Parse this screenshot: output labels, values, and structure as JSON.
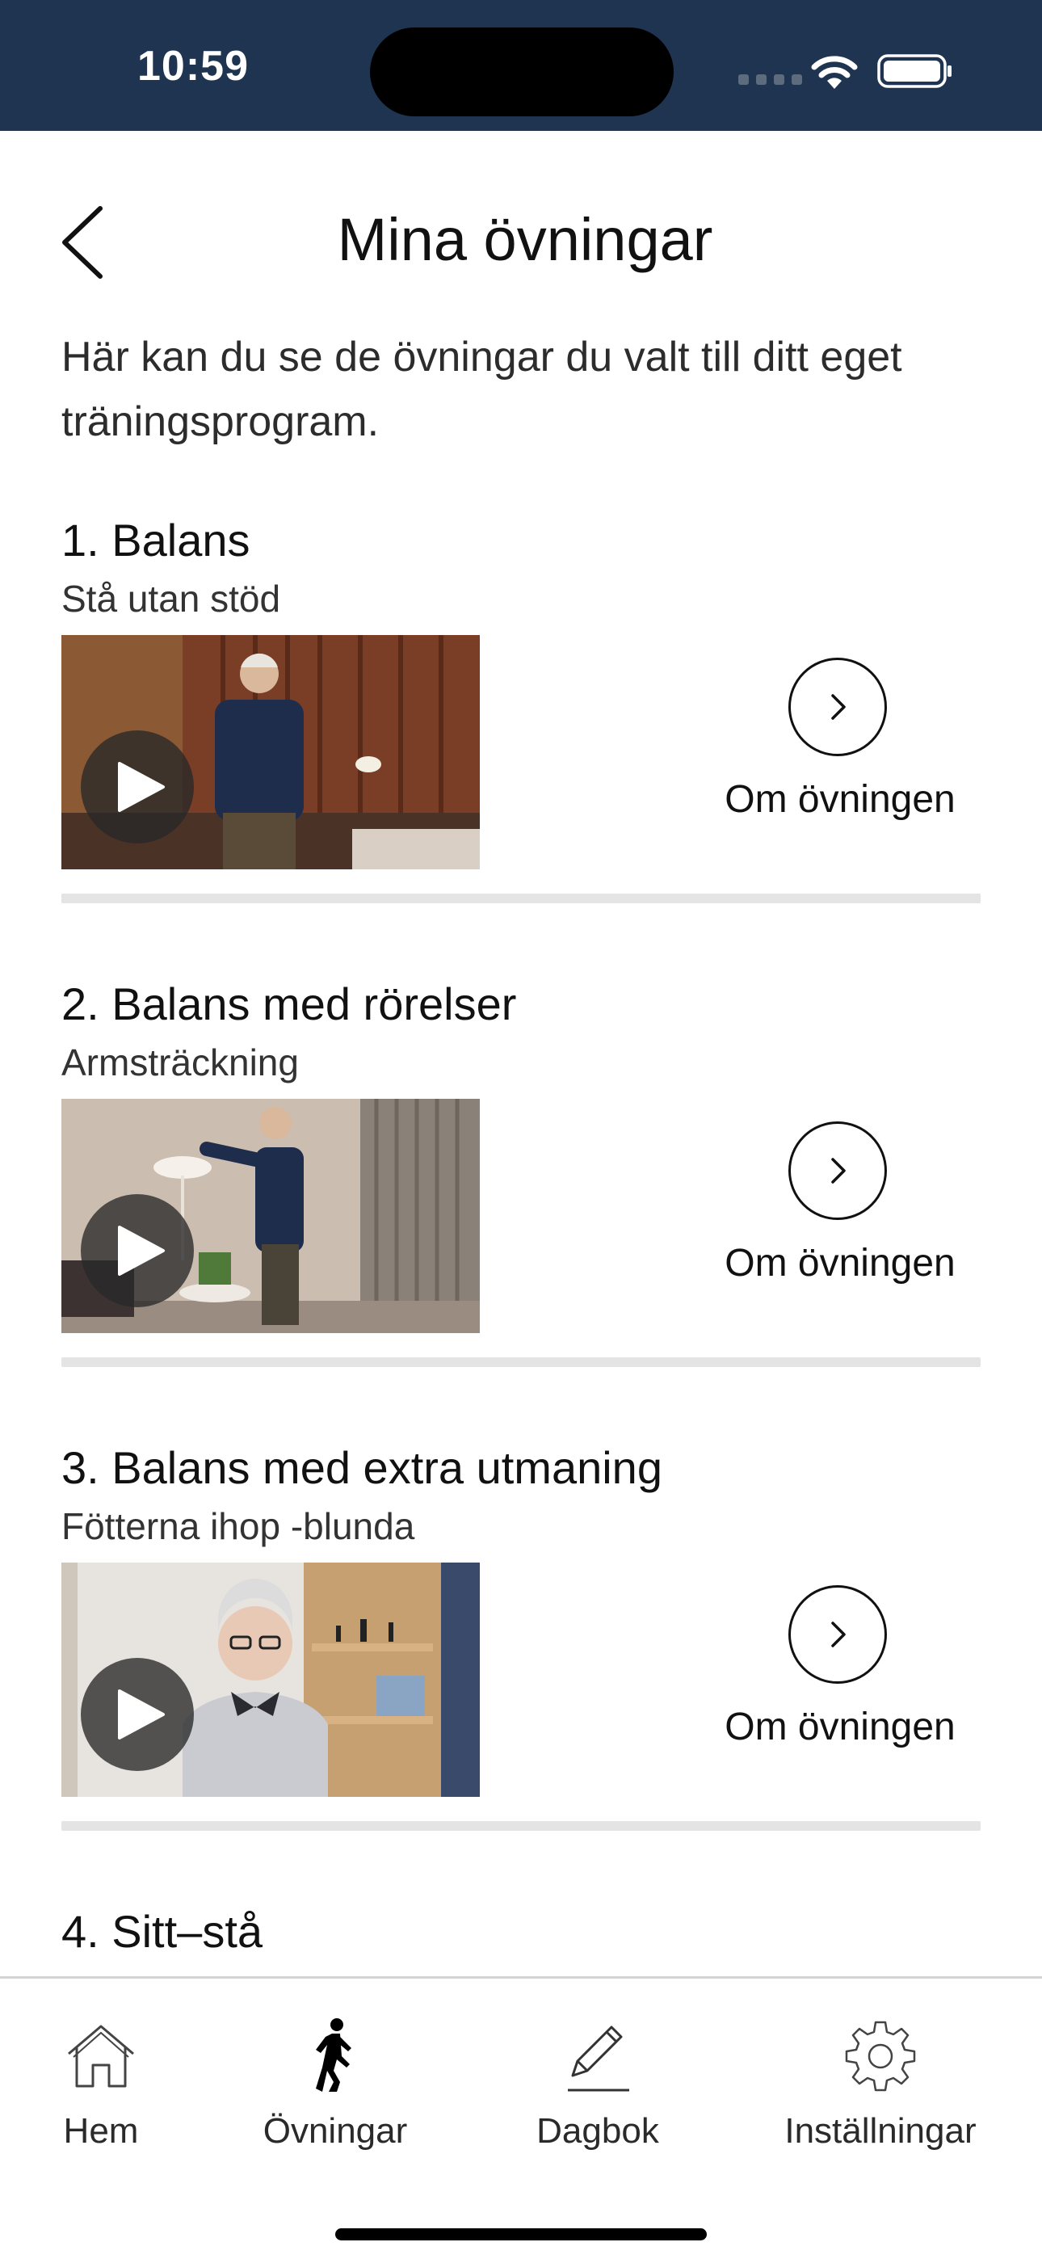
{
  "status_bar": {
    "time": "10:59"
  },
  "header": {
    "back_icon": "chevron-left-icon",
    "title": "Mina övningar"
  },
  "intro": {
    "text": "Här kan du se de övningar du valt till ditt eget träningsprogram."
  },
  "exercises": [
    {
      "title": "1. Balans",
      "subtitle": "Stå utan stöd",
      "about_label": "Om övningen"
    },
    {
      "title": "2. Balans med rörelser",
      "subtitle": "Armsträckning",
      "about_label": "Om övningen"
    },
    {
      "title": "3. Balans med extra utmaning",
      "subtitle": "Fötterna ihop -blunda",
      "about_label": "Om övningen"
    },
    {
      "title": "4. Sitt–stå"
    }
  ],
  "tab_bar": {
    "active_index": 1,
    "tabs": [
      {
        "label": "Hem",
        "icon": "house-icon"
      },
      {
        "label": "Övningar",
        "icon": "walking-person-icon"
      },
      {
        "label": "Dagbok",
        "icon": "pencil-icon"
      },
      {
        "label": "Inställningar",
        "icon": "gear-icon"
      }
    ]
  },
  "colors": {
    "status_bar_bg": "#1f3450",
    "divider": "#e4e4e4",
    "text": "#111111"
  }
}
